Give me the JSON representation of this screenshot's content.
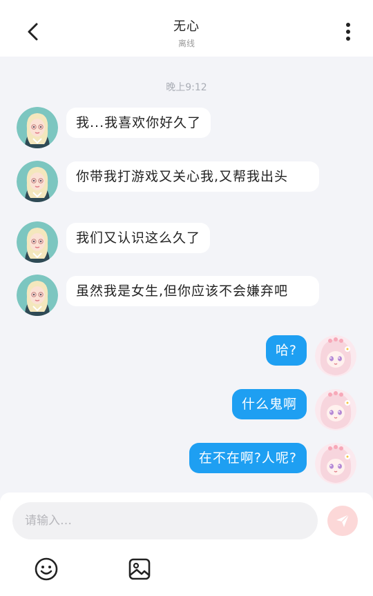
{
  "header": {
    "title": "无心",
    "status": "离线",
    "back_icon": "chevron-left-icon",
    "more_icon": "more-vertical-icon"
  },
  "chat": {
    "timestamp": "晚上9:12",
    "messages": [
      {
        "from": "contact",
        "text": "我...我喜欢你好久了"
      },
      {
        "from": "contact",
        "text": "你带我打游戏又关心我,又帮我出头"
      },
      {
        "from": "contact",
        "text": "我们又认识这么久了"
      },
      {
        "from": "contact",
        "text": "虽然我是女生,但你应该不会嫌弃吧"
      },
      {
        "from": "me",
        "text": "哈?"
      },
      {
        "from": "me",
        "text": "什么鬼啊"
      },
      {
        "from": "me",
        "text": "在不在啊?人呢?"
      }
    ]
  },
  "composer": {
    "placeholder": "请输入…",
    "value": "",
    "send_icon": "send-icon",
    "emoji_icon": "emoji-icon",
    "image_icon": "image-icon"
  },
  "colors": {
    "outgoing_bubble": "#1e9ff2",
    "incoming_bubble": "#ffffff",
    "background": "#f3f4f8",
    "send_button": "#fcd8d8"
  }
}
